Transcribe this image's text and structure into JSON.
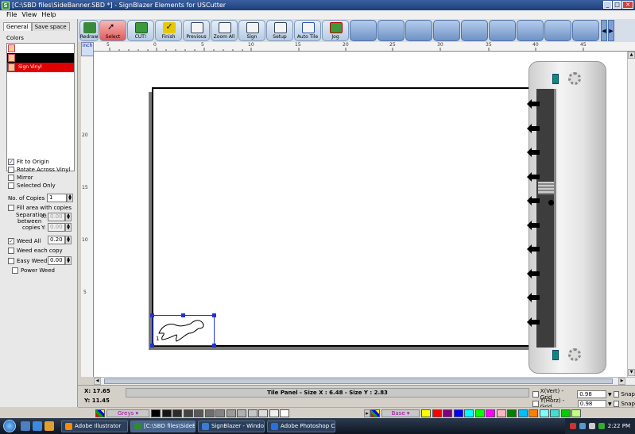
{
  "window": {
    "title": "[C:\\SBD files\\SideBanner.SBD *] - SignBlazer Elements for USCutter",
    "icon_letter": "S",
    "buttons": [
      "minimize-icon",
      "maximize-icon",
      "close-icon"
    ]
  },
  "menu": [
    "File",
    "View",
    "Help"
  ],
  "toolbar": {
    "buttons": [
      {
        "label": "Redraw",
        "icon": "redraw-icon"
      },
      {
        "label": "Select",
        "icon": "select-arrow-icon"
      },
      {
        "label": "CUT!",
        "icon": "cutter-icon"
      },
      {
        "label": "Finish",
        "icon": "finish-check-icon"
      },
      {
        "label": "Previous",
        "icon": "previous-icon"
      },
      {
        "label": "Zoom All",
        "icon": "zoom-all-icon"
      },
      {
        "label": "Sign",
        "icon": "sign-icon"
      },
      {
        "label": "Setup",
        "icon": "setup-icon"
      },
      {
        "label": "Auto Tile",
        "icon": "auto-tile-icon"
      },
      {
        "label": "Jog",
        "icon": "jog-icon"
      }
    ],
    "empty_slots": 10
  },
  "left_panel": {
    "tabs": [
      "General",
      "Save space"
    ],
    "colors_label": "Colors",
    "color_rows": [
      {
        "color": "#ffffff",
        "label": ""
      },
      {
        "color": "#000000",
        "label": ""
      },
      {
        "color": "#e00000",
        "label": "Sign Vinyl"
      }
    ],
    "options": {
      "fit_to_origin": "Fit to Origin",
      "rotate_across_vinyl": "Rotate Across Vinyl",
      "mirror": "Mirror",
      "selected_only": "Selected Only",
      "no_of_copies": "No. of Copies",
      "copies_value": "1",
      "fill_area": "Fill area with copies",
      "separation": "Separation",
      "between": "between",
      "copies": "copies",
      "x_label": "X:",
      "y_label": "Y:",
      "sep_x": "0.00",
      "sep_y": "0.00",
      "weed_all": "Weed All",
      "weed_all_value": "0.20",
      "weed_each_copy": "Weed each copy",
      "easy_weed": "Easy Weed",
      "easy_weed_value": "0.00",
      "power_weed": "Power Weed"
    },
    "checked": {
      "fit_to_origin": true,
      "weed_all": true
    }
  },
  "ruler": {
    "unit": "inch",
    "h_ticks": [
      "5",
      "0",
      "5",
      "10",
      "15",
      "20",
      "25",
      "30",
      "35",
      "40",
      "45"
    ],
    "v_ticks": [
      "20",
      "15",
      "10",
      "5"
    ]
  },
  "canvas": {
    "selection_copy_number": "1"
  },
  "status": {
    "x": "X: 17.65",
    "y": "Y: 11.45",
    "tile_panel": "Tile Panel - Size X : 6.48 - Size Y : 2.83",
    "x_vert_grid": "X(Vert) - Grid",
    "x_vert_value": "0.98",
    "y_horz_grid": "Y(Horz) - Grid",
    "y_horz_value": "0.98",
    "snap": "Snap"
  },
  "palette": {
    "left_set": "Greys",
    "right_set": "Base",
    "greys": [
      "#000000",
      "#161616",
      "#2c2c2c",
      "#424242",
      "#585858",
      "#6e6e6e",
      "#848484",
      "#9a9a9a",
      "#b0b0b0",
      "#c6c6c6",
      "#dcdcdc",
      "#f0f0f0",
      "#ffffff"
    ],
    "base": [
      "#ffff00",
      "#ff0000",
      "#800080",
      "#0000ff",
      "#00ffff",
      "#00ff00",
      "#ff00ff",
      "#ffb6c1",
      "#008000",
      "#00bfff",
      "#ff8000",
      "#80ffff",
      "#40e0d0",
      "#00cc00",
      "#c0ff80"
    ]
  },
  "taskbar": {
    "tasks": [
      {
        "label": "Adobe Illustrator",
        "color": "#ff8a00"
      },
      {
        "label": "[C:\\SBD files\\SideBa...",
        "color": "#2e8b2e"
      },
      {
        "label": "SignBlazer - Windo...",
        "color": "#3a7bd5"
      },
      {
        "label": "Adobe Photoshop C...",
        "color": "#2a6fdb"
      }
    ],
    "clock": "2:22 PM"
  }
}
